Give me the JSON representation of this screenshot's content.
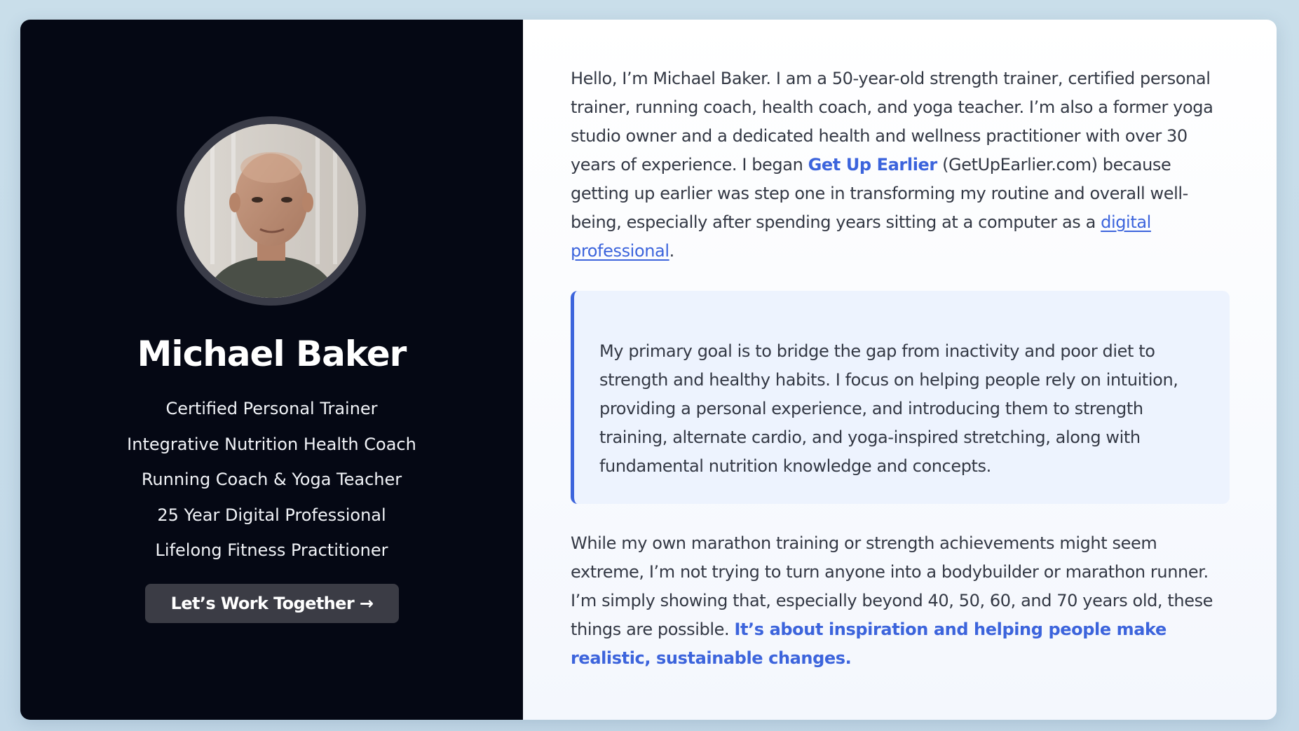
{
  "profile": {
    "name": "Michael Baker",
    "avatar_alt": "portrait",
    "credentials": [
      "Certified Personal Trainer",
      "Integrative Nutrition Health Coach",
      "Running Coach & Yoga Teacher",
      "25 Year Digital Professional",
      "Lifelong Fitness Practitioner"
    ],
    "cta_label": "Let’s Work Together →"
  },
  "bio": {
    "p1": {
      "a": "Hello, I’m Michael Baker. I am a 50-year-old strength trainer, certified personal trainer, running coach, health coach, and yoga teacher. I’m also a former yoga studio owner and a dedicated health and wellness practitioner with over 30 years of experience. I began ",
      "brand": "Get Up Earlier",
      "b": " (GetUpEarlier.com) because getting up earlier was step one in transforming my routine and overall well-being, especially after spending years sitting at a computer as a ",
      "link": "digital professional",
      "c": "."
    },
    "quote": "My primary goal is to bridge the gap from inactivity and poor diet to strength and healthy habits. I focus on helping people rely on intuition, providing a personal experience, and introducing them to strength training, alternate cardio, and yoga-inspired stretching, along with fundamental nutrition knowledge and concepts.",
    "p3": {
      "a": "While my own marathon training or strength achievements might seem extreme, I’m not trying to turn anyone into a bodybuilder or marathon runner. I’m simply showing that, especially beyond 40, 50, 60, and 70 years old, these things are possible. ",
      "highlight": "It’s about inspiration and helping people make realistic, sustainable changes."
    }
  },
  "colors": {
    "page_bg": "#c9deea",
    "left_panel": "#050814",
    "accent": "#3c64dc",
    "cta_bg": "#3b3c45",
    "quote_bg": "#edf3fe"
  }
}
